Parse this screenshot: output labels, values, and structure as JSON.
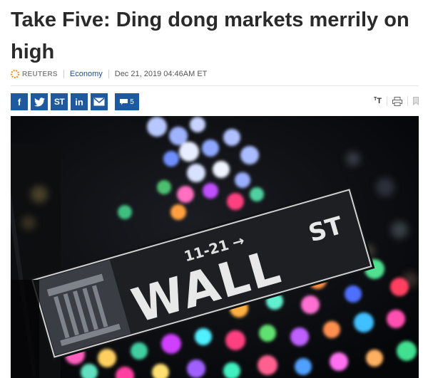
{
  "headline": "Take Five: Ding dong markets merrily on high",
  "meta": {
    "source": "REUTERS",
    "section": "Economy",
    "date": "Dec 21, 2019 04:46AM ET"
  },
  "share": {
    "buttons": [
      {
        "name": "facebook",
        "label": "f"
      },
      {
        "name": "twitter",
        "label": "t"
      },
      {
        "name": "stocktwits",
        "label": "ST"
      },
      {
        "name": "linkedin",
        "label": "in"
      },
      {
        "name": "email",
        "label": ""
      }
    ],
    "comments_count": "5"
  },
  "tools": {
    "text_size_label": "T",
    "icons": [
      "text-size-icon",
      "print-icon",
      "bookmark-icon"
    ]
  },
  "photo": {
    "sign_main": "WALL",
    "sign_suffix": "ST",
    "sign_number": "11-21",
    "sign_arrow": "→"
  },
  "colors": {
    "brand_blue": "#1d5a9f",
    "headline": "#2a2a2a",
    "section_link": "#1a4e8a"
  }
}
